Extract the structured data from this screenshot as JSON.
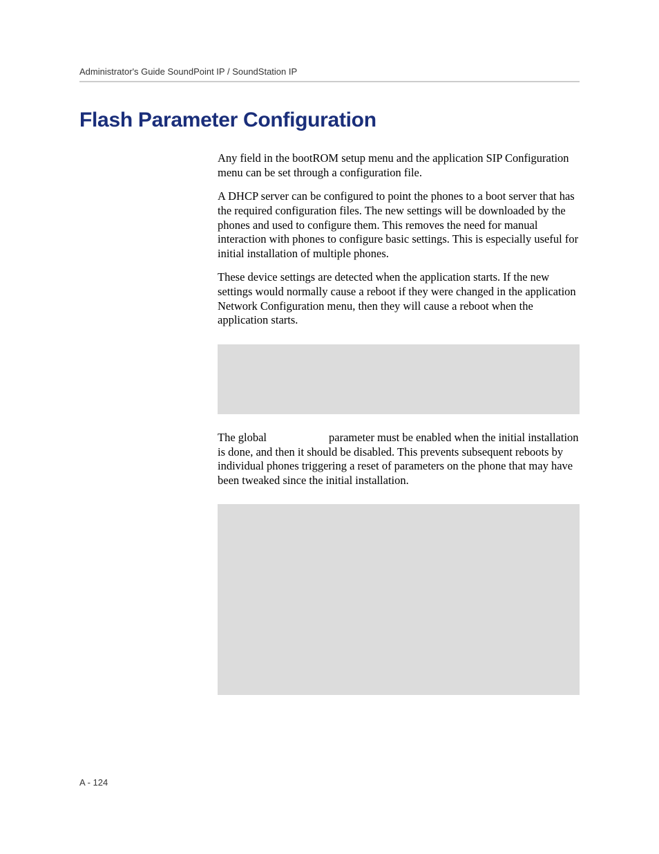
{
  "header": "Administrator's Guide SoundPoint IP / SoundStation IP",
  "title": "Flash Parameter Configuration",
  "para1": "Any field in the bootROM setup menu and the application SIP Configuration menu can be set through a configuration file.",
  "para2": "A DHCP server can be configured to point the phones to a boot server that has the required configuration files. The new settings will be downloaded by the phones and used to configure them. This removes the need for manual interaction with phones to configure basic settings. This is especially useful for initial installation of multiple phones.",
  "para3": "These device settings are detected when the application starts. If the new settings would normally cause a reboot if they were changed in the application Network Configuration menu, then they will cause a reboot when the application starts.",
  "para4_a": "The global",
  "para4_b": "parameter must be enabled when the initial installation is done, and then it should be disabled. This prevents subsequent reboots by individual phones triggering a reset of parameters on the phone that may have been tweaked since the initial installation.",
  "pageNumber": "A - 124"
}
